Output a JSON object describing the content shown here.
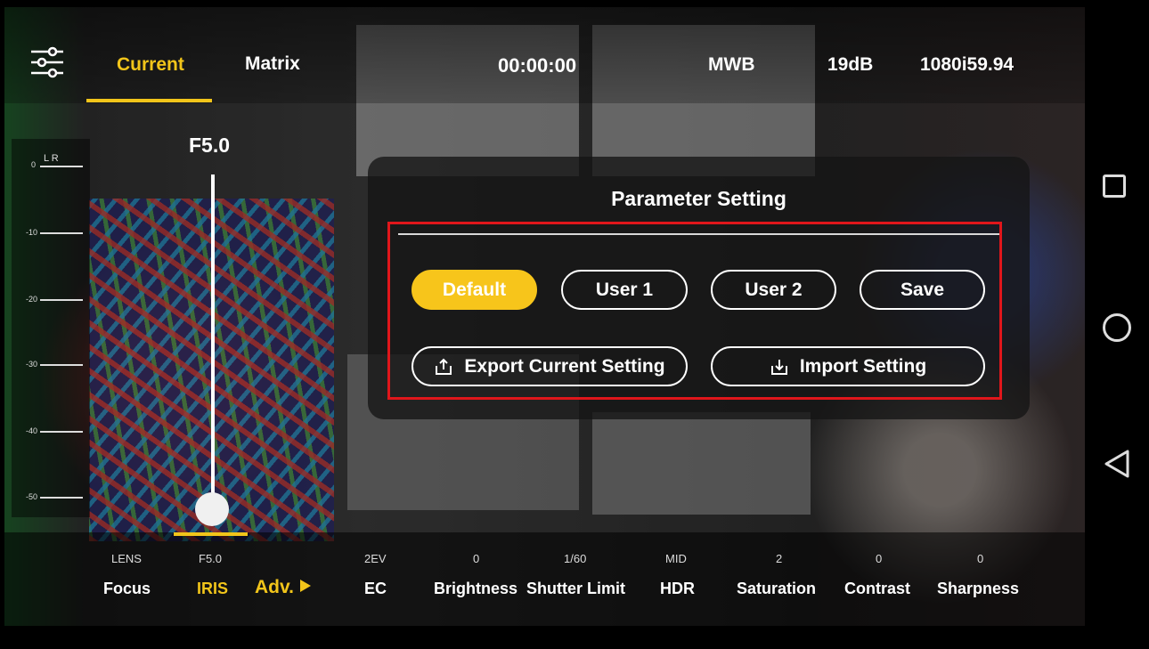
{
  "topbar": {
    "tabs": [
      {
        "label": "Current",
        "active": true
      },
      {
        "label": "Matrix",
        "active": false
      }
    ],
    "timecode": "00:00:00",
    "white_balance": "MWB",
    "gain": "19dB",
    "format": "1080i59.94"
  },
  "meter": {
    "channels": "L R",
    "ticks": [
      "0",
      "-10",
      "-20",
      "-30",
      "-40",
      "-50"
    ]
  },
  "iris": {
    "value": "F5.0",
    "level_fraction": 0.0
  },
  "panel": {
    "title": "Parameter Setting",
    "buttons": {
      "default": "Default",
      "user1": "User 1",
      "user2": "User 2",
      "save": "Save",
      "export": "Export Current Setting",
      "import": "Import Setting"
    }
  },
  "bottombar": {
    "items": [
      {
        "value": "LENS",
        "label": "Focus"
      },
      {
        "value": "F5.0",
        "label": "IRIS",
        "active": true
      },
      {
        "value": "",
        "label": "Adv."
      },
      {
        "value": "2EV",
        "label": "EC"
      },
      {
        "value": "0",
        "label": "Brightness"
      },
      {
        "value": "1/60",
        "label": "Shutter Limit"
      },
      {
        "value": "MID",
        "label": "HDR"
      },
      {
        "value": "2",
        "label": "Saturation"
      },
      {
        "value": "0",
        "label": "Contrast"
      },
      {
        "value": "0",
        "label": "Sharpness"
      }
    ]
  },
  "colors": {
    "accent": "#f7c51b",
    "highlight_border": "#e0161b"
  }
}
